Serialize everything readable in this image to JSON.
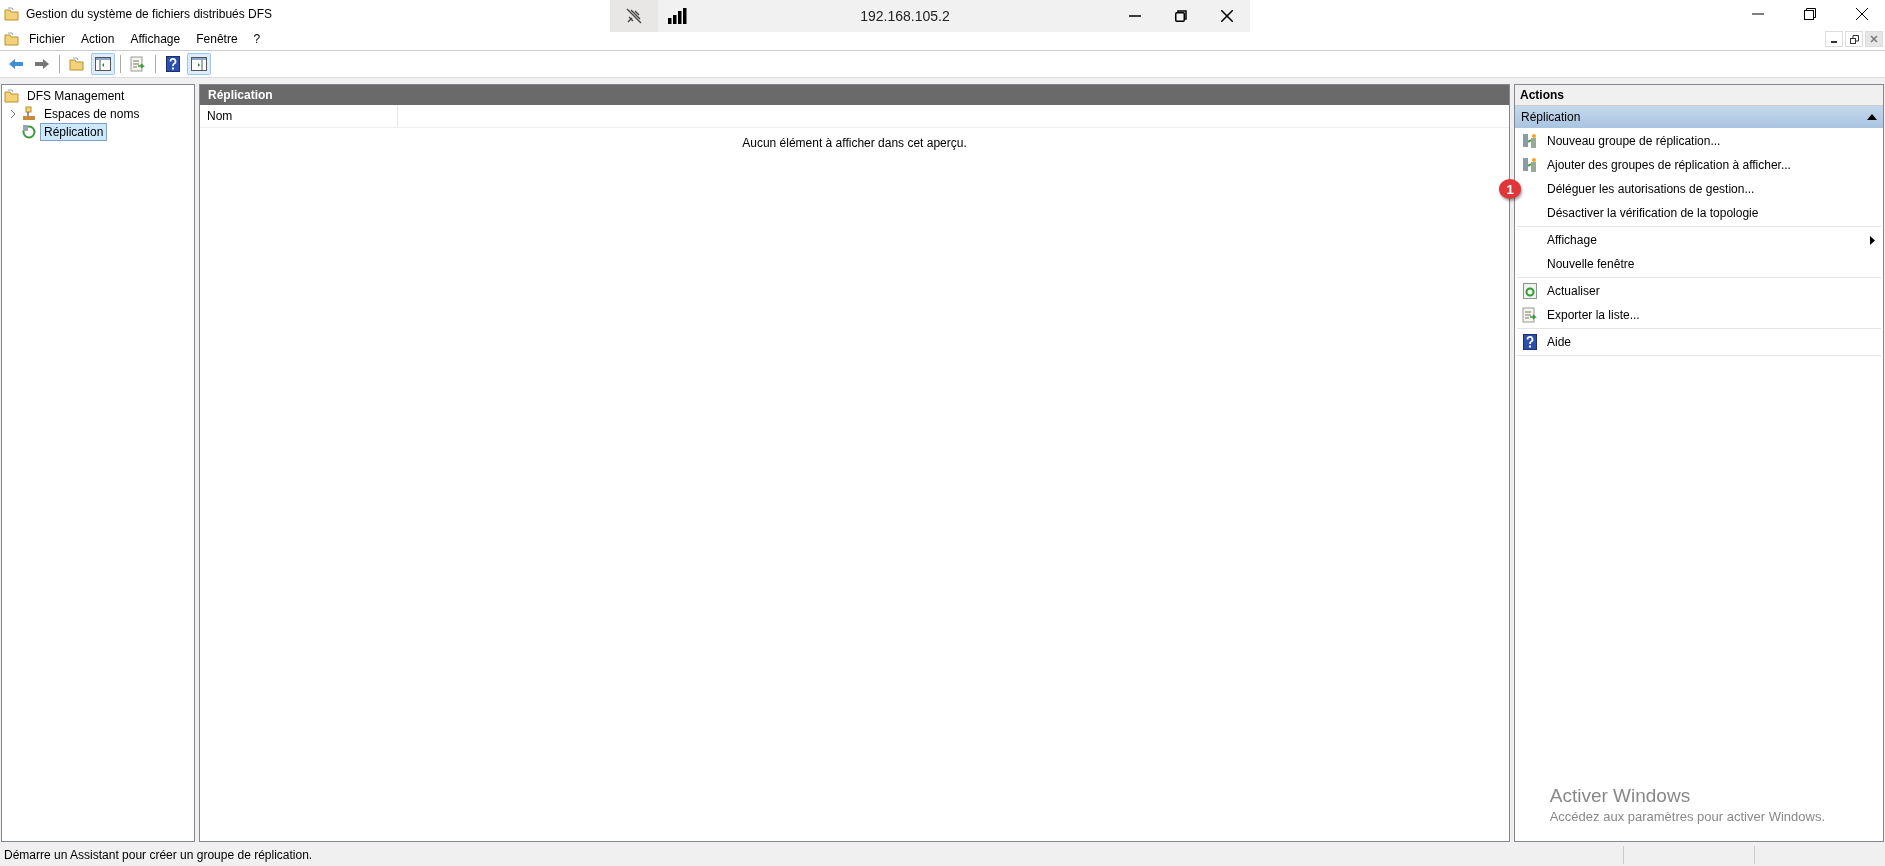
{
  "window": {
    "title": "Gestion du système de fichiers distribués DFS"
  },
  "remote_bar": {
    "address": "192.168.105.2",
    "pinned": false
  },
  "menu": [
    {
      "label": "Fichier"
    },
    {
      "label": "Action"
    },
    {
      "label": "Affichage"
    },
    {
      "label": "Fenêtre"
    },
    {
      "label": "?"
    }
  ],
  "toolbar": [
    {
      "kind": "back",
      "pressed": false
    },
    {
      "kind": "forward",
      "pressed": false
    },
    {
      "kind": "up",
      "pressed": false
    },
    {
      "kind": "tree",
      "pressed": true
    },
    {
      "kind": "export",
      "pressed": false
    },
    {
      "kind": "help",
      "pressed": false
    },
    {
      "kind": "actions",
      "pressed": true
    }
  ],
  "tree": {
    "label": "DFS Management",
    "selected": false,
    "children": [
      {
        "label": "Espaces de noms",
        "kind": "namespaces",
        "selected": false,
        "expanded": false
      },
      {
        "label": "Réplication",
        "kind": "replication",
        "selected": true
      }
    ]
  },
  "content": {
    "title": "Réplication",
    "columns": [
      "Nom"
    ],
    "empty_message": "Aucun élément à afficher dans cet aperçu."
  },
  "actions": {
    "title": "Actions",
    "section": {
      "label": "Réplication",
      "expanded": true
    },
    "groups": [
      [
        {
          "label": "Nouveau groupe de réplication...",
          "kind": "new-group",
          "submenu": false
        },
        {
          "label": "Ajouter des groupes de réplication à afficher...",
          "kind": "add-group",
          "submenu": false
        },
        {
          "label": "Déléguer les autorisations de gestion...",
          "kind": "plain",
          "submenu": false,
          "badge": "1"
        },
        {
          "label": "Désactiver la vérification de la topologie",
          "kind": "plain",
          "submenu": false
        }
      ],
      [
        {
          "label": "Affichage",
          "kind": "plain",
          "submenu": true
        },
        {
          "label": "Nouvelle fenêtre",
          "kind": "plain",
          "submenu": false
        }
      ],
      [
        {
          "label": "Actualiser",
          "kind": "refresh",
          "submenu": false
        },
        {
          "label": "Exporter la liste...",
          "kind": "export",
          "submenu": false
        }
      ],
      [
        {
          "label": "Aide",
          "kind": "help",
          "submenu": false
        }
      ]
    ]
  },
  "activation_notice": {
    "title": "Activer Windows",
    "text": "Accédez aux paramètres pour activer Windows."
  },
  "status_bar": {
    "text": "Démarre un Assistant pour créer un groupe de réplication."
  }
}
